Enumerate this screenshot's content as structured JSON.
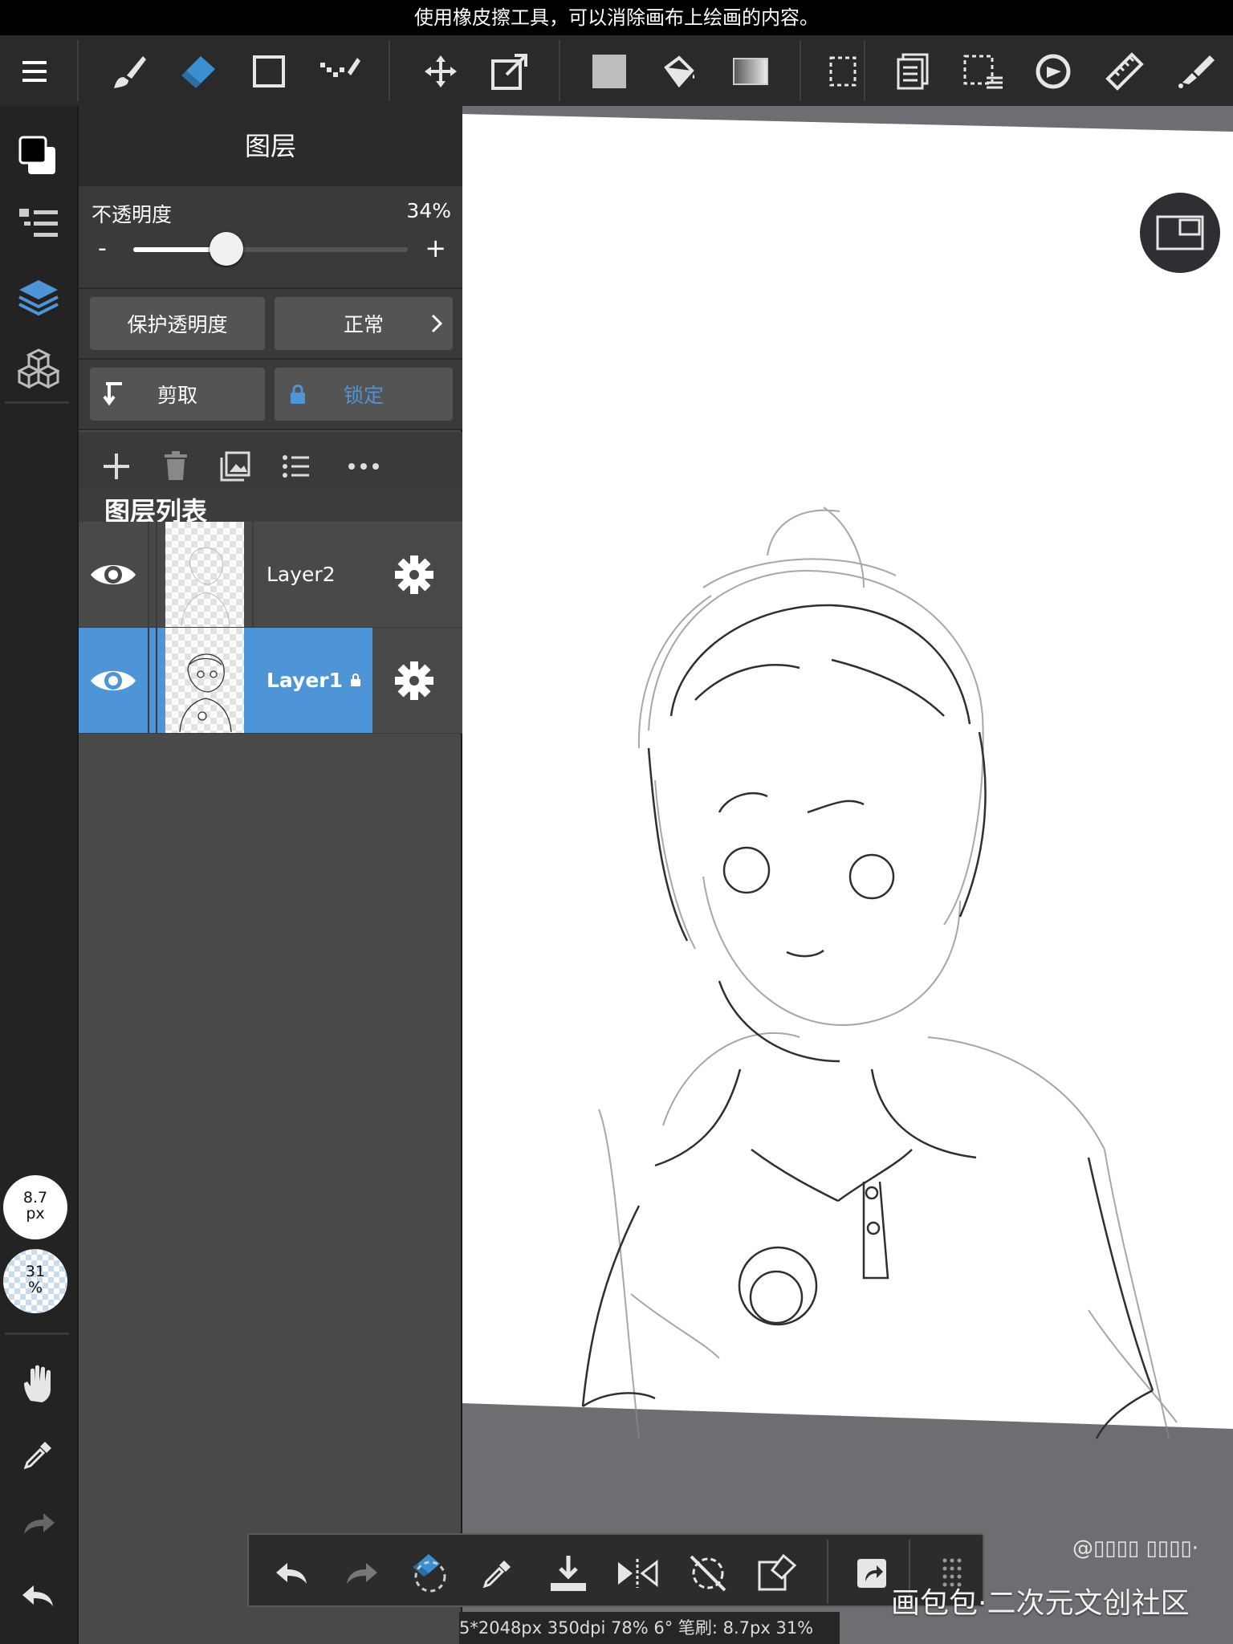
{
  "hint": "使用橡皮擦工具，可以消除画布上绘画的内容。",
  "toolbar": {
    "tools": [
      "menu-icon",
      "brush-icon",
      "eraser-icon",
      "rectangle-icon",
      "dot-brush-icon",
      "move-icon",
      "transform-icon",
      "fill-color-icon",
      "bucket-icon",
      "gradient-icon",
      "selection-icon",
      "copy-layer-icon",
      "select-menu-icon",
      "lasso-icon",
      "ruler-icon",
      "perspective-icon"
    ],
    "active_tool": "eraser-icon"
  },
  "layer_panel": {
    "title": "图层",
    "opacity_label": "不透明度",
    "opacity_value": "34%",
    "opacity_fraction": 0.34,
    "minus": "-",
    "plus": "+",
    "protect_alpha": "保护透明度",
    "blend_mode": "正常",
    "clip": "剪取",
    "lock": "锁定",
    "list_header": "图层列表",
    "layers": [
      {
        "name": "Layer2",
        "selected": false,
        "locked": false
      },
      {
        "name": "Layer1",
        "selected": true,
        "locked": true
      }
    ]
  },
  "sidebar": {
    "brush_size_value": "8.7",
    "brush_size_unit": "px",
    "brush_opacity_value": "31",
    "brush_opacity_unit": "%"
  },
  "status_bar": "5*2048px 350dpi 78% 6° 笔刷: 8.7px 31%",
  "watermark_top": "@▯▯▯▯ ▯▯▯▯·",
  "watermark": "画包包·二次元文创社区",
  "colors": {
    "accent": "#4e95d7",
    "eraser": "#3a8fd0"
  }
}
